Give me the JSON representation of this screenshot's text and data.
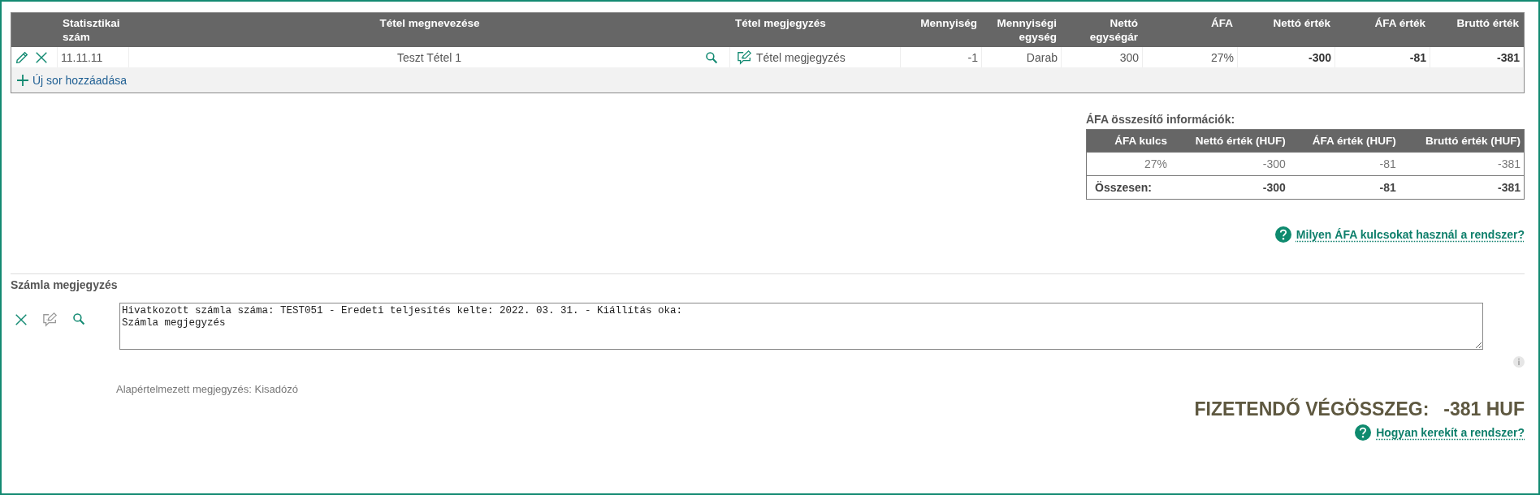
{
  "items_table": {
    "columns": [
      "Statisztikai szám",
      "Tétel megnevezése",
      "Tétel megjegyzés",
      "Mennyiség",
      "Mennyiségi egység",
      "Nettó egységár",
      "ÁFA",
      "Nettó érték",
      "ÁFA érték",
      "Bruttó érték"
    ],
    "rows": [
      {
        "cells": [
          "11.11.11",
          "Teszt Tétel 1",
          "Tétel megjegyzés",
          "-1",
          "Darab",
          "300",
          "27%",
          "-300",
          "-81",
          "-381"
        ]
      }
    ],
    "add_row_label": "Új sor hozzáadása"
  },
  "vat_summary": {
    "title": "ÁFA összesítő információk:",
    "columns": [
      "ÁFA kulcs",
      "Nettó érték (HUF)",
      "ÁFA érték (HUF)",
      "Bruttó érték (HUF)"
    ],
    "rows": [
      [
        "27%",
        "-300",
        "-81",
        "-381"
      ]
    ],
    "total": [
      "Összesen:",
      "-300",
      "-81",
      "-381"
    ],
    "help_link": "Milyen ÁFA kulcsokat használ a rendszer?"
  },
  "invoice_note": {
    "title": "Számla megjegyzés",
    "tools": [
      {
        "kind": "delete",
        "disabled": false
      },
      {
        "kind": "edit",
        "disabled": true
      },
      {
        "kind": "search",
        "disabled": false
      }
    ],
    "value": "Hivatkozott számla száma: TEST051 - Eredeti teljesítés kelte: 2022. 03. 31. - Kiállítás oka:\nSzámla megjegyzés",
    "default_note": "Alapértelmezett megjegyzés: Kisadózó"
  },
  "total_due": {
    "label": "FIZETENDŐ VÉGÖSSZEG:",
    "amount": "-381 HUF",
    "help_link": "Hogyan kerekít a rendszer?"
  }
}
